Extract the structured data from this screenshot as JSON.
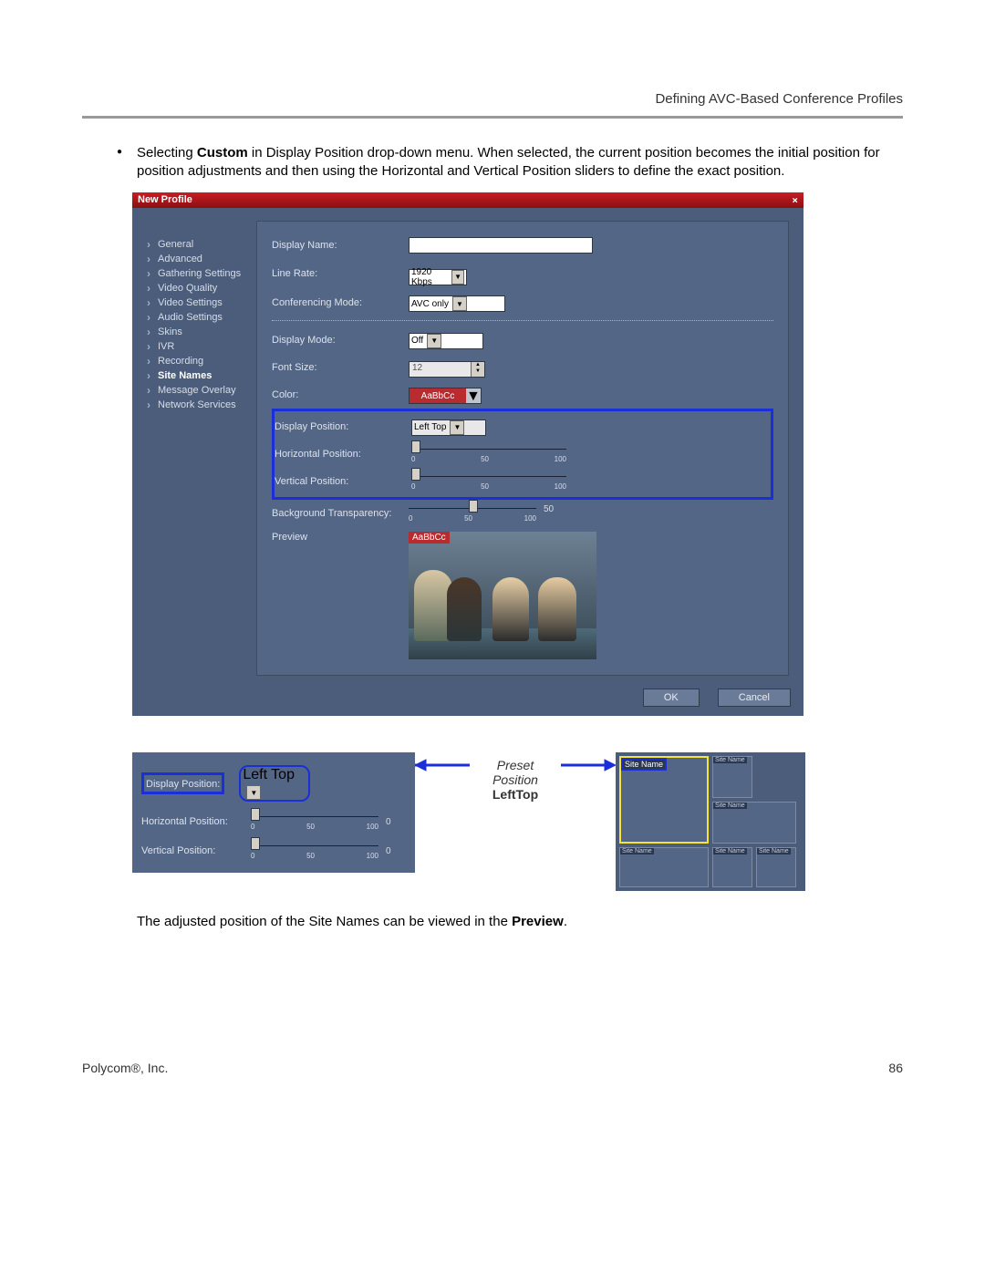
{
  "header": {
    "title": "Defining AVC-Based Conference Profiles"
  },
  "paragraphs": {
    "p1_a": "Selecting ",
    "p1_bold": "Custom",
    "p1_b": " in Display Position drop-down menu. When selected, the current position becomes the initial position for position adjustments and then using the Horizontal and Vertical Position sliders to define the exact position.",
    "p2_a": "The adjusted position of the Site Names can be viewed in the ",
    "p2_bold": "Preview",
    "p2_b": "."
  },
  "dialog": {
    "title": "New Profile",
    "sidebar": [
      "General",
      "Advanced",
      "Gathering Settings",
      "Video Quality",
      "Video Settings",
      "Audio Settings",
      "Skins",
      "IVR",
      "Recording",
      "Site Names",
      "Message Overlay",
      "Network Services"
    ],
    "sidebar_active_index": 9,
    "labels": {
      "display_name": "Display Name:",
      "line_rate": "Line Rate:",
      "conf_mode": "Conferencing Mode:",
      "display_mode": "Display Mode:",
      "font_size": "Font Size:",
      "color": "Color:",
      "display_position": "Display Position:",
      "horiz_position": "Horizontal Position:",
      "vert_position": "Vertical Position:",
      "bg_trans": "Background Transparency:",
      "preview": "Preview"
    },
    "values": {
      "line_rate": "1920 Kbps",
      "conf_mode": "AVC only",
      "display_mode": "Off",
      "font_size": "12",
      "color_sample": "AaBbCc",
      "display_position": "Left Top",
      "slider_min": "0",
      "slider_mid": "50",
      "slider_max": "100",
      "bg_trans_value": "50",
      "preview_badge": "AaBbCc"
    },
    "buttons": {
      "ok": "OK",
      "cancel": "Cancel"
    }
  },
  "illustration": {
    "labels": {
      "display_position": "Display Position:",
      "horiz_position": "Horizontal Position:",
      "vert_position": "Vertical Position:"
    },
    "values": {
      "display_position": "Left Top",
      "slider_min": "0",
      "slider_mid": "50",
      "slider_max": "100",
      "slider_right": "0"
    },
    "center": {
      "preset": "Preset",
      "position": "Position",
      "lefttop": "LeftTop"
    },
    "site_name": "Site Name"
  },
  "footer": {
    "company": "Polycom®, Inc.",
    "page": "86"
  }
}
